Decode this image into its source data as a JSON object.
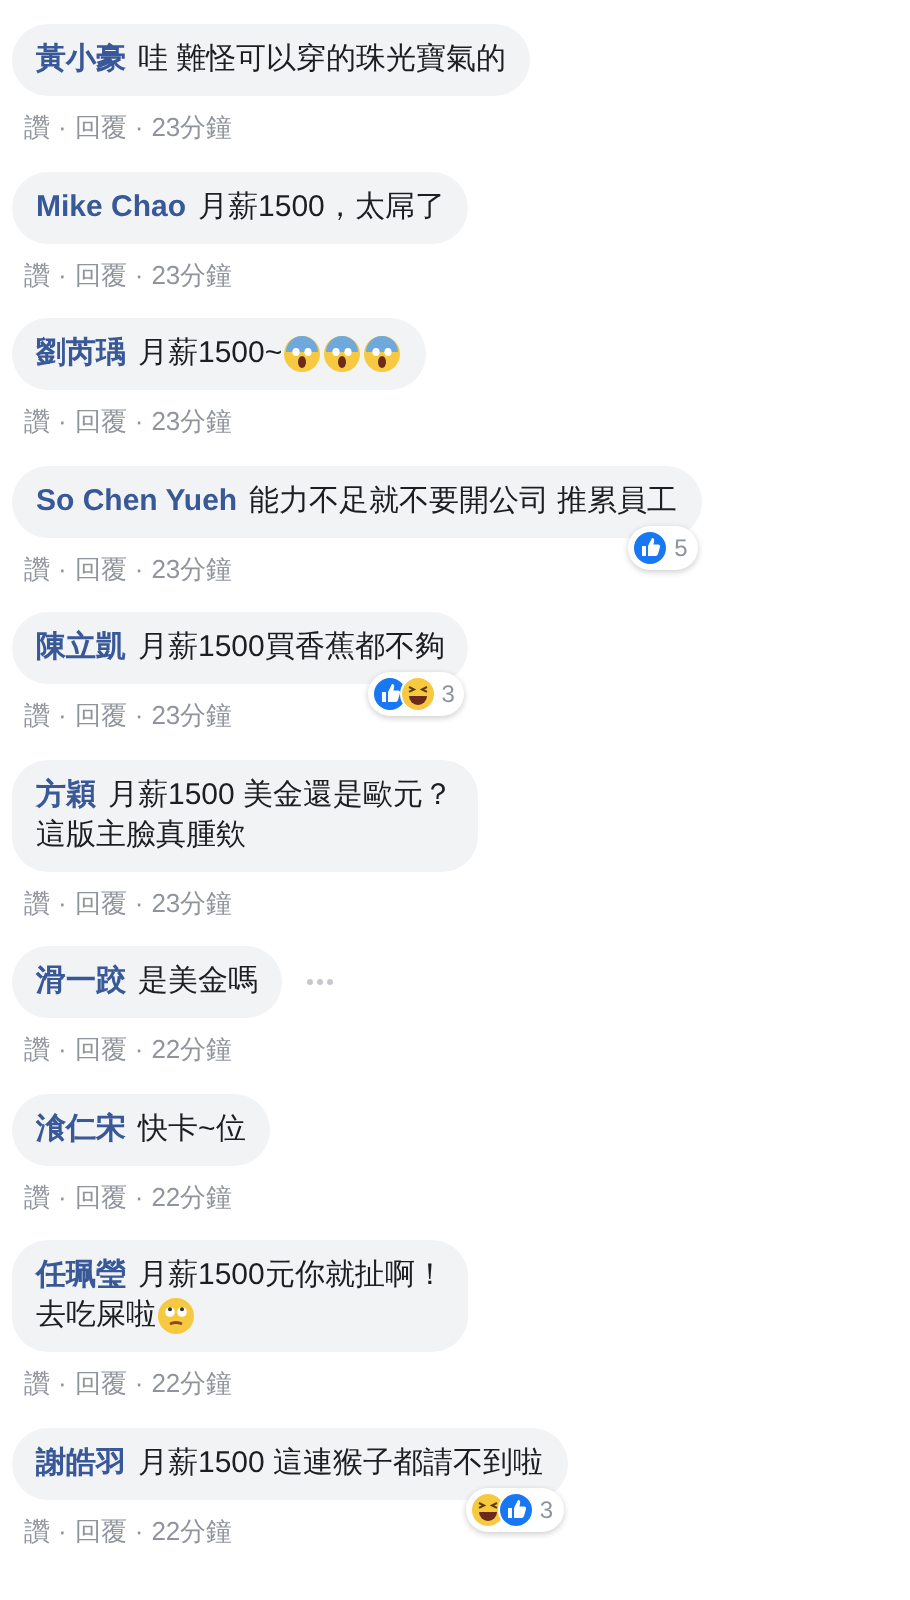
{
  "separator": "·",
  "comments": [
    {
      "author": "黃小豪",
      "lines": [
        "哇 難怪可以穿的珠光寶氣的"
      ],
      "actions": [
        "讚",
        "回覆"
      ],
      "time": "23分鐘",
      "more": false
    },
    {
      "author": "Mike Chao",
      "lines": [
        "月薪1500，太屌了"
      ],
      "actions": [
        "讚",
        "回覆"
      ],
      "time": "23分鐘",
      "more": false
    },
    {
      "author": "劉芮瑀",
      "lines": [
        "月薪1500~"
      ],
      "emojis": [
        {
          "kind": "scream"
        },
        {
          "kind": "scream"
        },
        {
          "kind": "scream"
        }
      ],
      "actions": [
        "讚",
        "回覆"
      ],
      "time": "23分鐘",
      "more": false
    },
    {
      "author": "So Chen Yueh",
      "lines": [
        "能力不足就不要開公司 推累員工"
      ],
      "actions": [
        "讚",
        "回覆"
      ],
      "time": "23分鐘",
      "reactions": [
        {
          "kind": "like"
        }
      ],
      "reaction_count": "5",
      "more": false
    },
    {
      "author": "陳立凱",
      "lines": [
        "月薪1500買香蕉都不夠"
      ],
      "actions": [
        "讚",
        "回覆"
      ],
      "time": "23分鐘",
      "reactions": [
        {
          "kind": "like"
        },
        {
          "kind": "haha"
        }
      ],
      "reaction_count": "3",
      "more": false
    },
    {
      "author": "方穎",
      "lines": [
        "月薪1500 美金還是歐元？",
        "這版主臉真腫欸"
      ],
      "actions": [
        "讚",
        "回覆"
      ],
      "time": "23分鐘",
      "more": false
    },
    {
      "author": "滑一跤",
      "lines": [
        "是美金嗎"
      ],
      "actions": [
        "讚",
        "回覆"
      ],
      "time": "22分鐘",
      "more": true
    },
    {
      "author": "湌仁宋",
      "lines": [
        "快卡~位"
      ],
      "actions": [
        "讚",
        "回覆"
      ],
      "time": "22分鐘",
      "more": false
    },
    {
      "author": "任珮瑩",
      "lines": [
        "月薪1500元你就扯啊！",
        "去吃屎啦"
      ],
      "emojis": [
        {
          "kind": "eyeroll"
        }
      ],
      "actions": [
        "讚",
        "回覆"
      ],
      "time": "22分鐘",
      "more": false
    },
    {
      "author": "謝皓羽",
      "lines": [
        "月薪1500 這連猴子都請不到啦"
      ],
      "actions": [
        "讚",
        "回覆"
      ],
      "time": "22分鐘",
      "reactions": [
        {
          "kind": "haha"
        },
        {
          "kind": "like"
        }
      ],
      "reaction_count": "3",
      "more": false
    }
  ]
}
